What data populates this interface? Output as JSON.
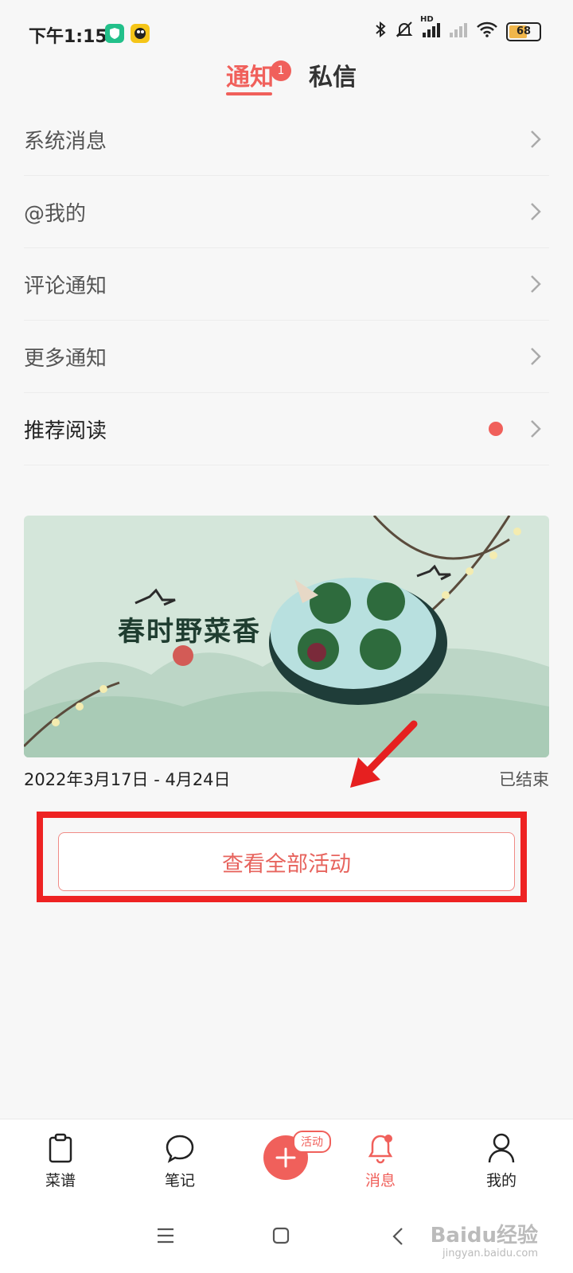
{
  "status_bar": {
    "time": "下午1:15",
    "network_label": "HD",
    "battery": "68",
    "battery_fraction": 0.68
  },
  "tabs": [
    {
      "label": "通知",
      "active": true,
      "badge": "1"
    },
    {
      "label": "私信",
      "active": false
    }
  ],
  "list": {
    "items": [
      {
        "label": "系统消息"
      },
      {
        "label": "@我的"
      },
      {
        "label": "评论通知"
      },
      {
        "label": "更多通知"
      },
      {
        "label": "推荐阅读",
        "has_dot": true
      }
    ]
  },
  "event": {
    "banner_title": "春时野菜香",
    "dates": "2022年3月17日 - 4月24日",
    "status": "已结束"
  },
  "view_all_button": "查看全部活动",
  "bottom_nav": {
    "items": [
      {
        "label": "菜谱",
        "icon": "clipboard-icon"
      },
      {
        "label": "笔记",
        "icon": "chat-bubble-icon"
      },
      {
        "label": "消息",
        "icon": "bell-icon",
        "active": true
      },
      {
        "label": "我的",
        "icon": "person-icon"
      }
    ],
    "add_tag": "活动"
  },
  "watermark": {
    "brand": "Baidu经验",
    "url": "jingyan.baidu.com"
  },
  "colors": {
    "accent": "#f0605b",
    "highlight_box": "#ee2222",
    "banner_bg": "#cfe3d7"
  }
}
